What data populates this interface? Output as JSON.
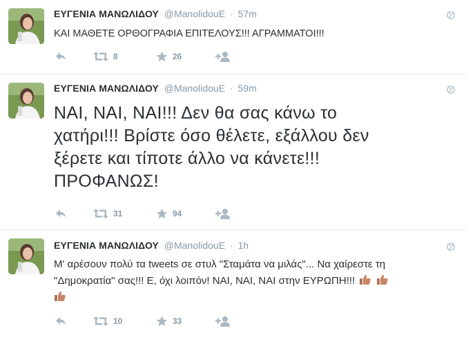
{
  "colors": {
    "name": "#292f33",
    "muted": "#8899a6",
    "action_icon": "#aab8c2",
    "background": "#e9eaeb"
  },
  "icons": [
    "reply-icon",
    "retweet-icon",
    "favorite-icon",
    "follow-icon",
    "globe-icon",
    "thumbs-up-emoji"
  ],
  "tweets": [
    {
      "fullname": "ΕΥΓΕΝΙΑ ΜΑΝΩΛΙΔΟΥ",
      "username": "@ManolidouE",
      "separator": "·",
      "time": "57m",
      "text": "ΚΑΙ ΜΑΘΕΤΕ ΟΡΘΟΓΡΑΦΙΑ ΕΠΙΤΕΛΟΥΣ!!! ΑΓΡΑΜΜΑΤΟΙ!!!",
      "retweets": "8",
      "favorites": "26"
    },
    {
      "fullname": "ΕΥΓΕΝΙΑ ΜΑΝΩΛΙΔΟΥ",
      "username": "@ManolidouE",
      "separator": "·",
      "time": "59m",
      "text_lines": [
        "ΝΑΙ, ΝΑΙ, ΝΑΙ!!! Δεν θα σας κάνω το",
        "χατήρι!!! Βρίστε όσο θέλετε, εξάλλου δεν",
        "ξέρετε και τίποτε άλλο να κάνετε!!!",
        "ΠΡΟΦΑΝΩΣ!"
      ],
      "retweets": "31",
      "favorites": "94"
    },
    {
      "fullname": "ΕΥΓΕΝΙΑ ΜΑΝΩΛΙΔΟΥ",
      "username": "@ManolidouE",
      "separator": "·",
      "time": "1h",
      "text_line1": "Μ' αρέσουν πολύ τα tweets σε στυλ \"Σταμάτα να μιλάς\"... Να χαίρεστε τη",
      "text_line2": "\"Δημοκρατία\" σας!!! Ε, όχι λοιπόν! ΝΑΙ, ΝΑΙ, ΝΑΙ στην ΕΥΡΩΠΗ!!!",
      "retweets": "10",
      "favorites": "33"
    }
  ]
}
